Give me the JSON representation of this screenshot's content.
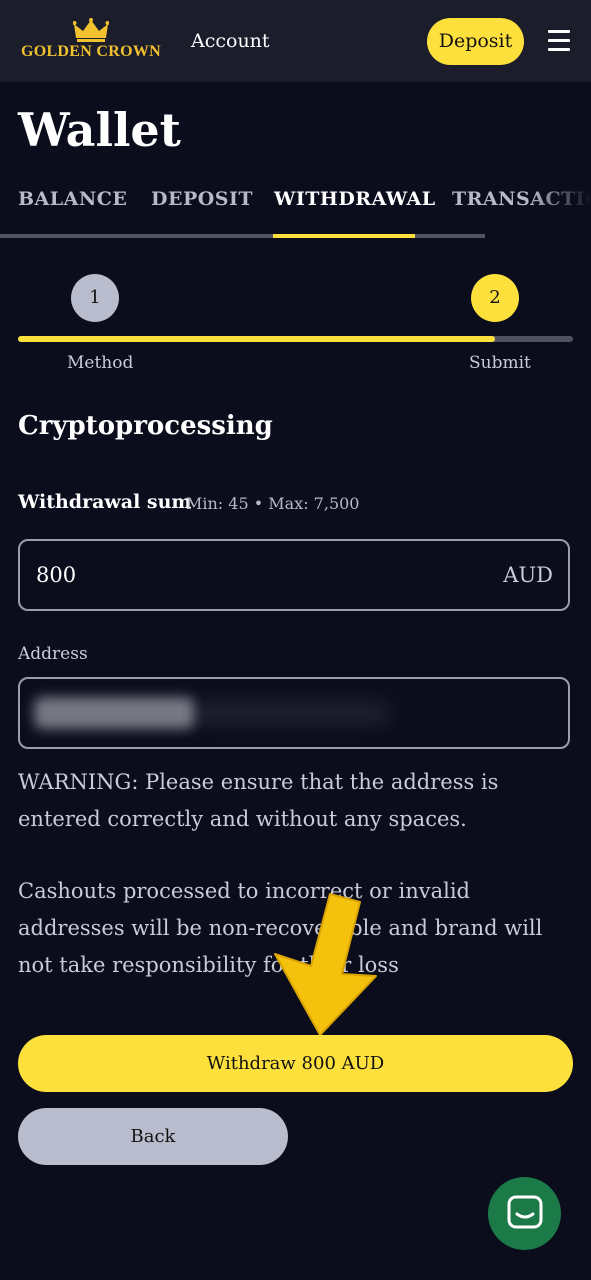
{
  "header": {
    "brand": "GOLDEN CROWN",
    "account_label": "Account",
    "deposit_label": "Deposit"
  },
  "page": {
    "title": "Wallet"
  },
  "tabs": [
    {
      "label": "BALANCE",
      "active": false
    },
    {
      "label": "DEPOSIT",
      "active": false
    },
    {
      "label": "WITHDRAWAL",
      "active": true
    },
    {
      "label": "TRANSACTIONS",
      "active": false
    }
  ],
  "steps": {
    "items": [
      {
        "number": "1",
        "label": "Method"
      },
      {
        "number": "2",
        "label": "Submit"
      }
    ],
    "progress": 0.86
  },
  "form": {
    "method_title": "Cryptoprocessing",
    "sum_label": "Withdrawal sum",
    "sum_range": "Min: 45 • Max: 7,500",
    "amount_value": "800",
    "currency": "AUD",
    "address_label": "Address"
  },
  "messages": {
    "warning": "WARNING: Please ensure that the address is entered correctly and without any spaces.",
    "notice": "Cashouts processed to incorrect or invalid addresses will be non-recoverable and brand will not take responsibility for their loss"
  },
  "actions": {
    "withdraw_label": "Withdraw 800 AUD",
    "back_label": "Back"
  },
  "colors": {
    "background": "#0b0c1c",
    "accent": "#fde03b",
    "header": "#1b1d2b",
    "chat": "#1b7a47"
  }
}
